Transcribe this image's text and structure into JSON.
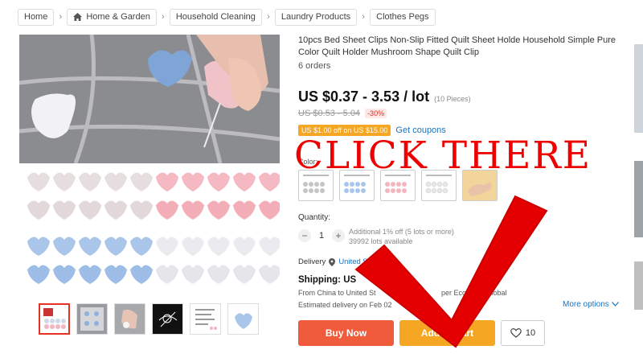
{
  "breadcrumb": [
    {
      "label": "Home"
    },
    {
      "label": "Home & Garden"
    },
    {
      "label": "Household Cleaning"
    },
    {
      "label": "Laundry Products"
    },
    {
      "label": "Clothes Pegs"
    }
  ],
  "product": {
    "title": "10pcs Bed Sheet Clips Non-Slip Fitted Quilt Sheet Holde Household Simple Pure Color Quilt Holder Mushroom Shape Quilt Clip",
    "orders": "6 orders",
    "price": "US $0.37 - 3.53 / lot",
    "pieces": "(10 Pieces)",
    "old_price": "US $0.53 - 5.04",
    "discount": "-30%",
    "coupon": "US $1.00 off on US $15.00",
    "coupon_link": "Get coupons",
    "color_label": "Color:",
    "quantity_label": "Quantity:",
    "quantity_value": "1",
    "quantity_info_1": "Additional 1% off (5 lots or more)",
    "quantity_info_2": "39992 lots available",
    "delivery_label": "Delivery",
    "delivery_link": "United States",
    "shipping": "Shipping: US",
    "ship_from": "From China to United St",
    "ship_eco": "per Economy Global",
    "ship_est": "Estimated delivery on Feb 02",
    "more_options": "More options",
    "buy_now": "Buy Now",
    "add_to_cart": "Add to Cart",
    "wishlist_count": "10"
  },
  "overlay": {
    "text": "CLICK THERE",
    "color": "#ee0000"
  },
  "icons": {
    "home": "home-icon",
    "location": "location-pin-icon",
    "heart": "heart-icon",
    "plus": "plus-icon",
    "minus": "minus-icon",
    "chevron": "chevron-down-icon"
  },
  "colors": {
    "buy": "#f05b3c",
    "cart": "#f5a623",
    "link": "#1a73c2",
    "price_text": "#111111"
  },
  "separators": ">"
}
